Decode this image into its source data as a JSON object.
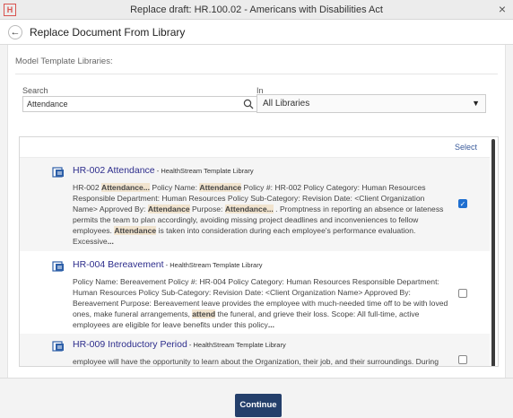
{
  "window": {
    "logo_text": "H",
    "title": "Replace draft: HR.100.02 - Americans with Disabilities Act",
    "close": "×"
  },
  "header": {
    "back_glyph": "←",
    "title": "Replace Document From Library"
  },
  "section": {
    "label": "Model Template Libraries:"
  },
  "search": {
    "label": "Search",
    "value": "Attendance",
    "icon": "search-icon"
  },
  "filter": {
    "label": "In",
    "value": "All Libraries",
    "caret": "▼"
  },
  "list": {
    "select_label": "Select",
    "items": [
      {
        "name": "HR-002 Attendance",
        "library": " - HealthStream Template Library",
        "checked": true,
        "snippet": [
          {
            "t": "HR-002 "
          },
          {
            "t": "Attendance...",
            "h": true
          },
          {
            "t": " Policy Name: "
          },
          {
            "t": "Attendance",
            "h": true
          },
          {
            "t": " Policy #: HR-002 Policy Category: Human Resources Responsible Department: Human Resources Policy Sub-Category: Revision Date:  <Client Organization Name> Approved By:  "
          },
          {
            "t": "Attendance",
            "h": true
          },
          {
            "t": "   Purpose:   "
          },
          {
            "t": "Attendance...",
            "h": true
          },
          {
            "t": " . Promptness in reporting an absence or lateness permits the team to plan accordingly, avoiding missing project deadlines and inconveniences to fellow employees. "
          },
          {
            "t": "Attendance",
            "h": true
          },
          {
            "t": " is taken into consideration during each employee's performance evaluation. Excessive"
          },
          {
            "t": "...",
            "e": true
          }
        ]
      },
      {
        "name": "HR-004 Bereavement",
        "library": " - HealthStream Template Library",
        "checked": false,
        "snippet": [
          {
            "t": "Policy Name: Bereavement Policy #: HR-004 Policy Category: Human Resources Responsible Department: Human Resources Policy Sub-Category: Revision Date:  <Client Organization Name> Approved By:   Bereavement  Purpose:   Bereavement leave provides the employee with much-needed time off to be with loved ones, make funeral arrangements, "
          },
          {
            "t": "attend",
            "h": true
          },
          {
            "t": " the funeral, and grieve their loss.  Scope:   All full-time, active employees are eligible for leave benefits under this policy"
          },
          {
            "t": "...",
            "e": true
          }
        ]
      },
      {
        "name": "HR-009 Introductory Period",
        "library": " - HealthStream Template Library",
        "checked": false,
        "snippet": [
          {
            "t": "employee will have the opportunity to learn about the Organization, their job, and their surroundings. During"
          }
        ]
      }
    ]
  },
  "footer": {
    "continue_label": "Continue"
  },
  "colors": {
    "primary": "#243f6b",
    "link": "#2d2d8c",
    "highlight": "#f1e4cf",
    "checkbox": "#1f6fd0"
  }
}
